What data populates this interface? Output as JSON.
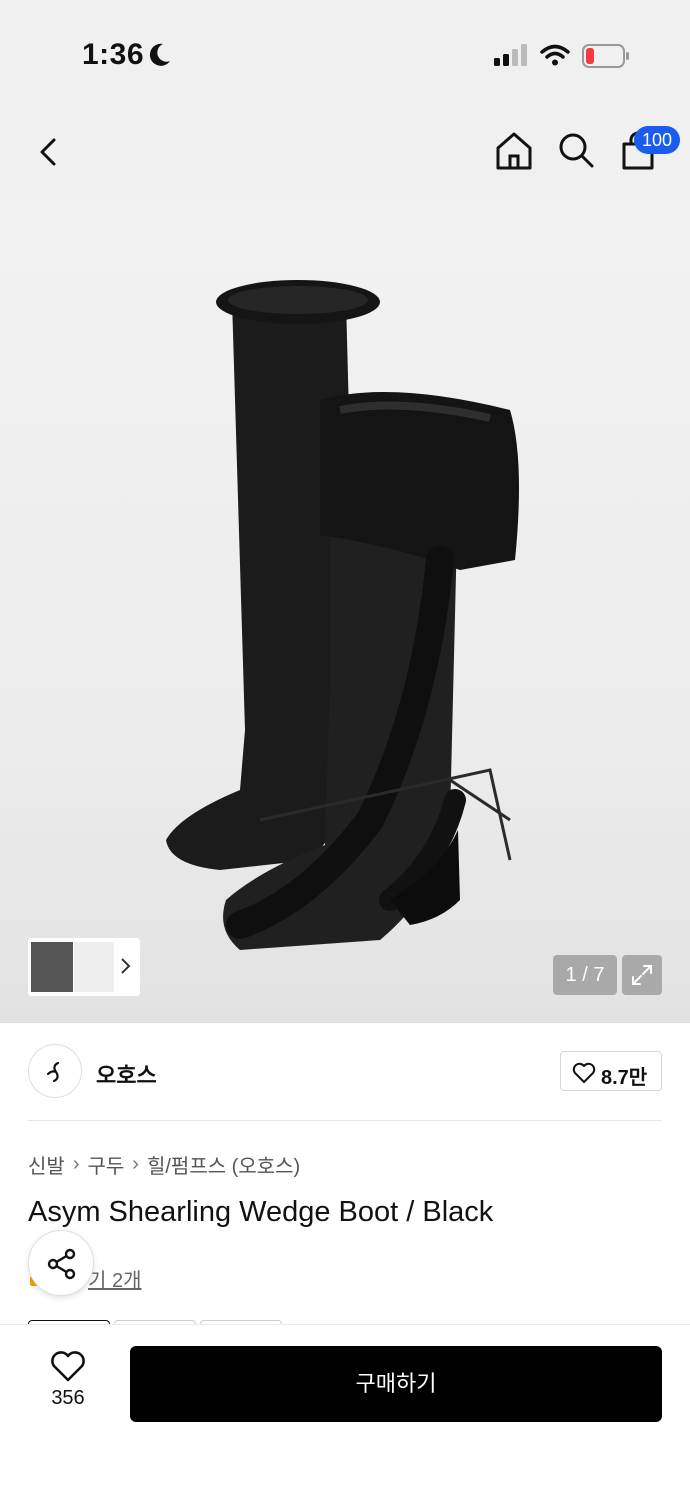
{
  "status_bar": {
    "time": "1:36",
    "icons": [
      "moon-icon",
      "signal-icon",
      "wifi-icon",
      "battery-icon"
    ]
  },
  "nav": {
    "cart_badge": "100",
    "icons": [
      "back-chevron-icon",
      "home-icon",
      "search-icon",
      "cart-icon"
    ],
    "badge_color": "#1a5cf0"
  },
  "gallery": {
    "pager": "1 / 7",
    "current": 1,
    "total": 7
  },
  "brand": {
    "name": "오호스",
    "likes": "8.7만"
  },
  "breadcrumb": {
    "items": [
      "신발",
      "구두",
      "힐/펌프스 (오호스)"
    ]
  },
  "product": {
    "title": "Asym Shearling Wedge Boot / Black",
    "review_text": "후기 2개",
    "review_visible": "기 2개"
  },
  "bottom_bar": {
    "wish_count": "356",
    "buy_label": "구매하기"
  }
}
